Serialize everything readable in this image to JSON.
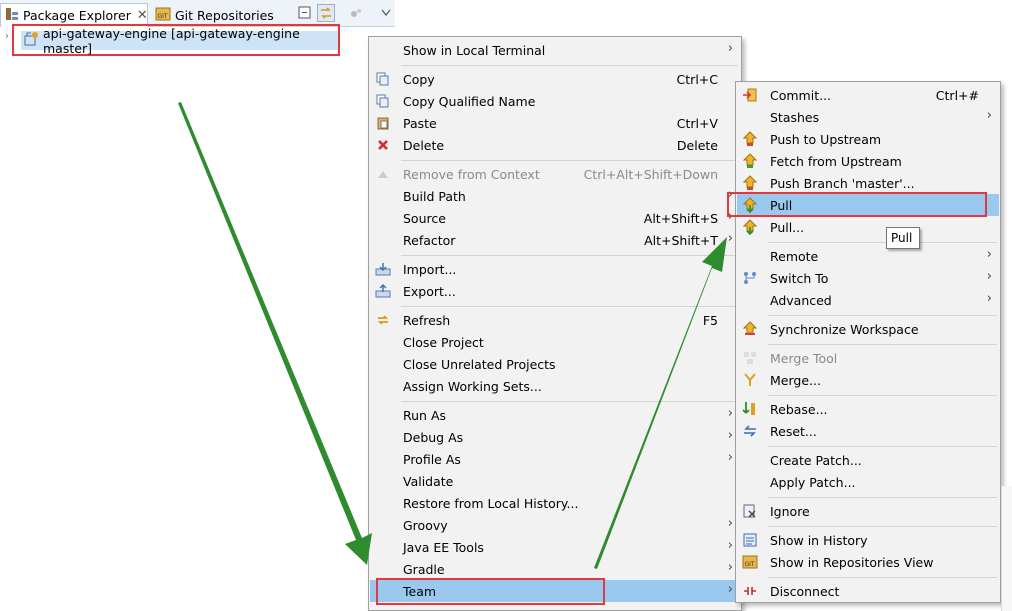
{
  "tabs": {
    "package_explorer": "Package Explorer",
    "git_repositories": "Git Repositories"
  },
  "tree": {
    "project_label": "api-gateway-engine [api-gateway-engine master]"
  },
  "context_menu": {
    "show_local_terminal": "Show in Local Terminal",
    "copy": "Copy",
    "copy_sc": "Ctrl+C",
    "copy_qualified": "Copy Qualified Name",
    "paste": "Paste",
    "paste_sc": "Ctrl+V",
    "delete": "Delete",
    "delete_sc": "Delete",
    "remove_context": "Remove from Context",
    "remove_context_sc": "Ctrl+Alt+Shift+Down",
    "build_path": "Build Path",
    "source": "Source",
    "source_sc": "Alt+Shift+S",
    "refactor": "Refactor",
    "refactor_sc": "Alt+Shift+T",
    "import": "Import...",
    "export": "Export...",
    "refresh": "Refresh",
    "refresh_sc": "F5",
    "close_project": "Close Project",
    "close_unrelated": "Close Unrelated Projects",
    "assign_working_sets": "Assign Working Sets...",
    "run_as": "Run As",
    "debug_as": "Debug As",
    "profile_as": "Profile As",
    "validate": "Validate",
    "restore_history": "Restore from Local History...",
    "groovy": "Groovy",
    "java_ee_tools": "Java EE Tools",
    "gradle": "Gradle",
    "team": "Team"
  },
  "team_menu": {
    "commit": "Commit...",
    "commit_sc": "Ctrl+#",
    "stashes": "Stashes",
    "push_upstream": "Push to Upstream",
    "fetch_upstream": "Fetch from Upstream",
    "push_branch": "Push Branch 'master'...",
    "pull": "Pull",
    "pull_dots": "Pull...",
    "remote": "Remote",
    "switch_to": "Switch To",
    "advanced": "Advanced",
    "sync_workspace": "Synchronize Workspace",
    "merge_tool": "Merge Tool",
    "merge": "Merge...",
    "rebase": "Rebase...",
    "reset": "Reset...",
    "create_patch": "Create Patch...",
    "apply_patch": "Apply Patch...",
    "ignore": "Ignore",
    "show_history": "Show in History",
    "show_repos_view": "Show in Repositories View",
    "disconnect": "Disconnect"
  },
  "tooltip": {
    "text": "Pull"
  },
  "colors": {
    "highlight": "#99c9ef",
    "annotation_red": "#e0393e",
    "annotation_arrow": "#2e8b2e"
  },
  "icons": {
    "package_explorer": "package-explorer-icon",
    "git_repositories": "git-repositories-icon",
    "project": "java-project-icon"
  }
}
